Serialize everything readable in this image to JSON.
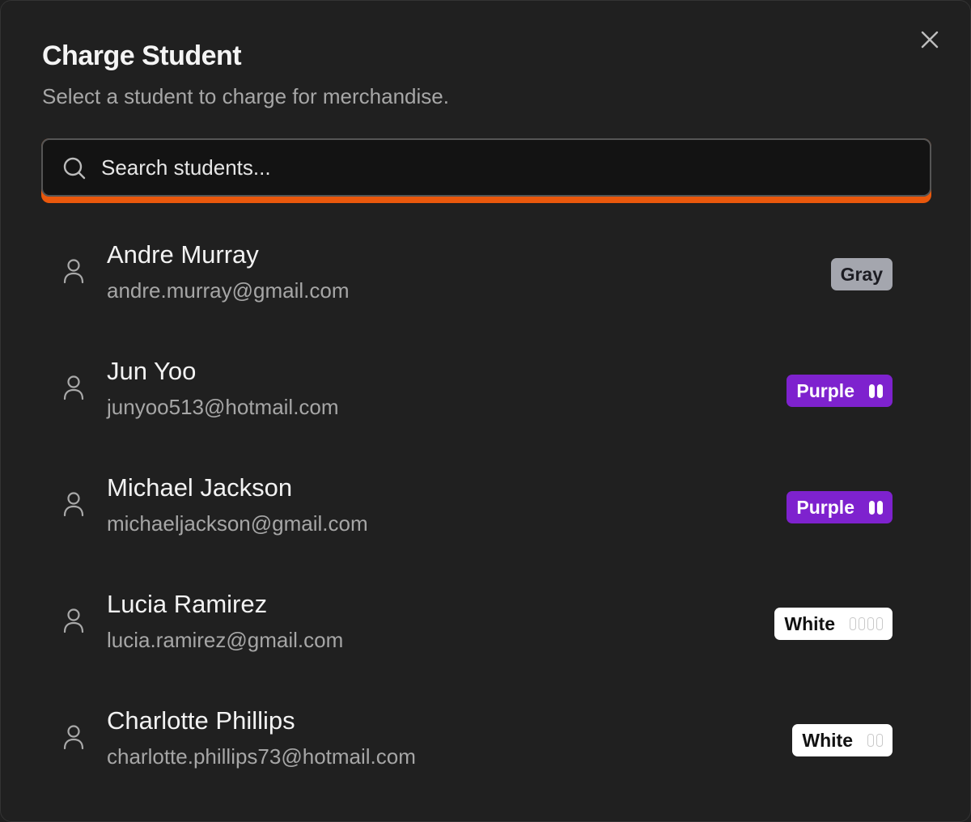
{
  "dialog": {
    "title": "Charge Student",
    "subtitle": "Select a student to charge for merchandise.",
    "close_icon": "close-icon"
  },
  "search": {
    "placeholder": "Search students...",
    "value": "",
    "icon": "search-icon",
    "focus_ring_color": "#ea580c"
  },
  "students": [
    {
      "name": "Andre Murray",
      "email": "andre.murray@gmail.com",
      "belt": "Gray",
      "belt_bg": "#a4a6ae",
      "belt_text_color": "#1c1c22",
      "stripes": 0,
      "stripe_color": "#a4a6ae"
    },
    {
      "name": "Jun Yoo",
      "email": "junyoo513@hotmail.com",
      "belt": "Purple",
      "belt_bg": "#7e22ce",
      "belt_text_color": "#ffffff",
      "stripes": 2,
      "stripe_color": "#ffffff"
    },
    {
      "name": "Michael Jackson",
      "email": "michaeljackson@gmail.com",
      "belt": "Purple",
      "belt_bg": "#7e22ce",
      "belt_text_color": "#ffffff",
      "stripes": 2,
      "stripe_color": "#ffffff"
    },
    {
      "name": "Lucia Ramirez",
      "email": "lucia.ramirez@gmail.com",
      "belt": "White",
      "belt_bg": "#ffffff",
      "belt_text_color": "#111111",
      "stripes": 4,
      "stripe_color": "#c9c9c9"
    },
    {
      "name": "Charlotte Phillips",
      "email": "charlotte.phillips73@hotmail.com",
      "belt": "White",
      "belt_bg": "#ffffff",
      "belt_text_color": "#111111",
      "stripes": 2,
      "stripe_color": "#c9c9c9"
    }
  ]
}
